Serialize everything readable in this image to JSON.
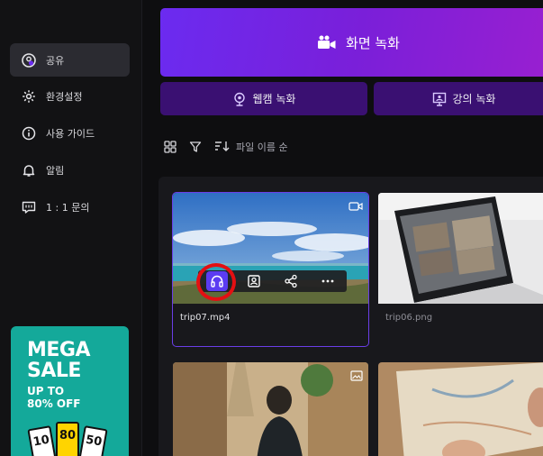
{
  "sidebar": {
    "items": [
      {
        "label": "공유",
        "icon": "share-user-icon",
        "active": true
      },
      {
        "label": "환경설정",
        "icon": "gear-icon"
      },
      {
        "label": "사용 가이드",
        "icon": "info-icon"
      },
      {
        "label": "알림",
        "icon": "bell-icon"
      },
      {
        "label": "1 : 1 문의",
        "icon": "chat-icon"
      }
    ],
    "promo": {
      "line1": "MEGA",
      "line2": "SALE",
      "line3": "UP TO",
      "line4": "80% OFF",
      "coupons": [
        "10",
        "80",
        "50"
      ]
    }
  },
  "actions": {
    "record_screen": "화면 녹화",
    "record_webcam": "웹캠 녹화",
    "record_lecture": "강의 녹화"
  },
  "toolbar": {
    "sort_label": "파일 이름 순"
  },
  "files": [
    {
      "name": "trip07.mp4",
      "type": "video",
      "selected": true
    },
    {
      "name": "trip06.png",
      "type": "image"
    },
    {
      "name": "",
      "type": "image"
    },
    {
      "name": "",
      "type": "image"
    }
  ],
  "colors": {
    "accent": "#6b2bf0",
    "sub_button": "#3a1072",
    "selection": "#6a3ee8",
    "highlight_ring": "#e40f12"
  }
}
